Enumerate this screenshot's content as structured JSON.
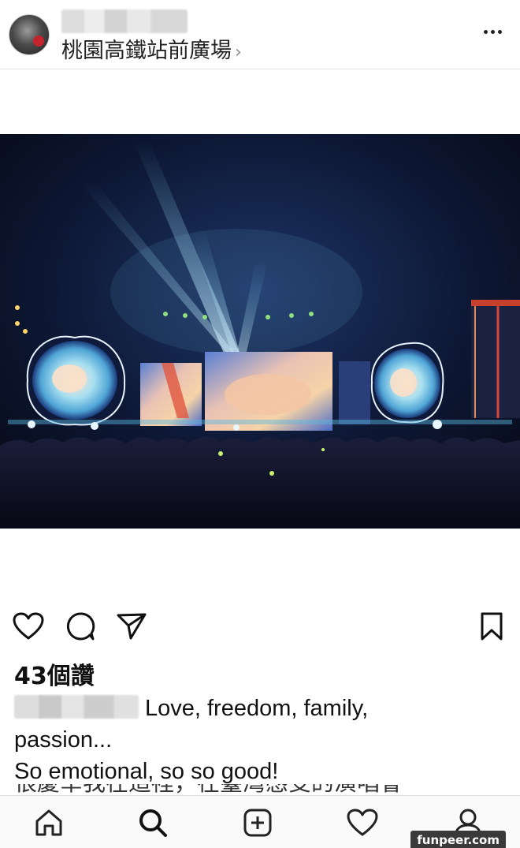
{
  "post": {
    "location": "桃園高鐵站前廣場",
    "location_chevron": "›",
    "likes": "43個讚",
    "caption_line1": "Love, freedom, family,",
    "caption_line2": "passion...",
    "caption_line3": "So emotional, so so good!",
    "caption_partial": "很慶幸我在這裡，在臺灣感受的演唱會"
  },
  "icons": {
    "more": "more-options-icon",
    "like": "heart-icon",
    "comment": "comment-icon",
    "share": "send-icon",
    "save": "bookmark-icon",
    "nav": [
      "home-icon",
      "search-icon",
      "add-post-icon",
      "activity-heart-icon",
      "profile-icon"
    ]
  },
  "watermark": "funpeer.com",
  "colors": {
    "photo_bg": "#0b1022",
    "stage_light": "#7ad0ff",
    "screen_warm": "#f0a68a"
  }
}
